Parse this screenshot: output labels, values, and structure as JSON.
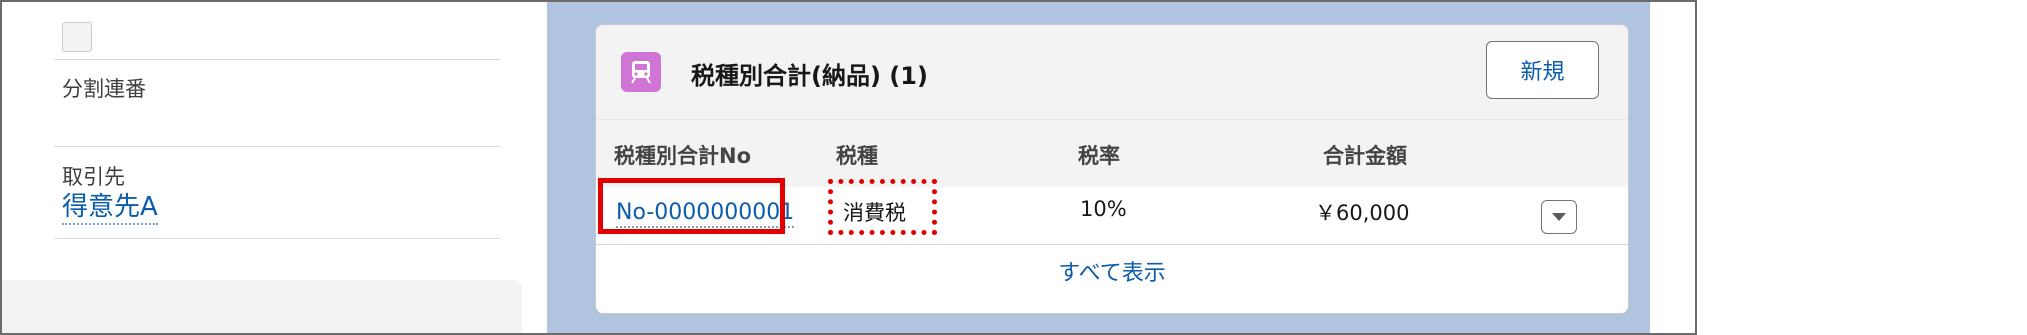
{
  "left_panel": {
    "checkbox_checked": false,
    "fields": [
      {
        "label": "分割連番",
        "value": ""
      },
      {
        "label": "取引先",
        "value": "得意先A"
      }
    ]
  },
  "related_list": {
    "title": "税種別合計(納品) (1)",
    "icon": "truck-icon",
    "icon_color": "#d075d6",
    "new_button": "新規",
    "columns": [
      "税種別合計No",
      "税種",
      "税率",
      "合計金額"
    ],
    "rows": [
      {
        "no": "No-0000000001",
        "tax_type": "消費税",
        "rate": "10%",
        "total": "￥60,000"
      }
    ],
    "view_all": "すべて表示"
  },
  "colors": {
    "link": "#0b5cab",
    "highlight": "#e00000",
    "backdrop": "#b0c4df"
  }
}
